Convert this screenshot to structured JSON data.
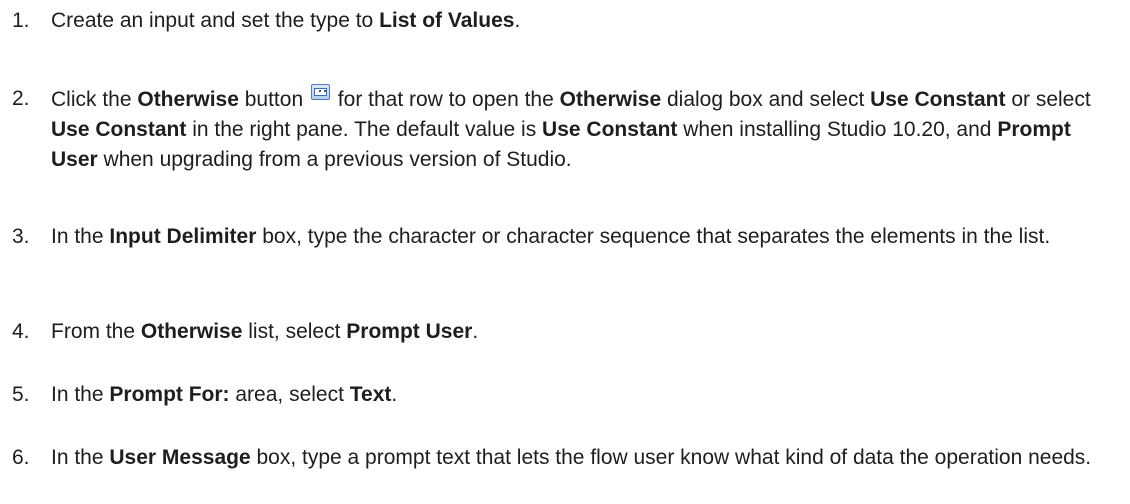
{
  "steps": [
    {
      "number": "1.",
      "segments": [
        {
          "text": "Create an input and set the type to "
        },
        {
          "text": "List of Values",
          "bold": true
        },
        {
          "text": "."
        }
      ]
    },
    {
      "number": "2.",
      "segments": [
        {
          "text": "Click the "
        },
        {
          "text": "Otherwise",
          "bold": true
        },
        {
          "text": " button "
        },
        {
          "icon": "otherwise-button-icon"
        },
        {
          "text": " for that row to open the "
        },
        {
          "text": "Otherwise",
          "bold": true
        },
        {
          "text": " dialog box and select "
        },
        {
          "text": "Use Constant",
          "bold": true
        },
        {
          "text": " or select "
        },
        {
          "text": "Use Constant",
          "bold": true
        },
        {
          "text": " in the right pane. The default value is "
        },
        {
          "text": "Use Constant",
          "bold": true
        },
        {
          "text": " when installing Studio 10.20, and "
        },
        {
          "text": "Prompt User",
          "bold": true
        },
        {
          "text": " when upgrading from a previous version of Studio."
        }
      ]
    },
    {
      "number": "3.",
      "segments": [
        {
          "text": "In the "
        },
        {
          "text": "Input Delimiter",
          "bold": true
        },
        {
          "text": " box, type the character or character sequence that separates the elements in the list."
        }
      ]
    },
    {
      "number": "4.",
      "segments": [
        {
          "text": "From the "
        },
        {
          "text": "Otherwise",
          "bold": true
        },
        {
          "text": " list, select "
        },
        {
          "text": "Prompt User",
          "bold": true
        },
        {
          "text": "."
        }
      ]
    },
    {
      "number": "5.",
      "segments": [
        {
          "text": "In the "
        },
        {
          "text": "Prompt For:",
          "bold": true
        },
        {
          "text": " area, select "
        },
        {
          "text": "Text",
          "bold": true
        },
        {
          "text": "."
        }
      ]
    },
    {
      "number": "6.",
      "segments": [
        {
          "text": "In the "
        },
        {
          "text": "User Message",
          "bold": true
        },
        {
          "text": " box, type a prompt text that lets the flow user know what kind of data the operation needs."
        }
      ]
    }
  ]
}
